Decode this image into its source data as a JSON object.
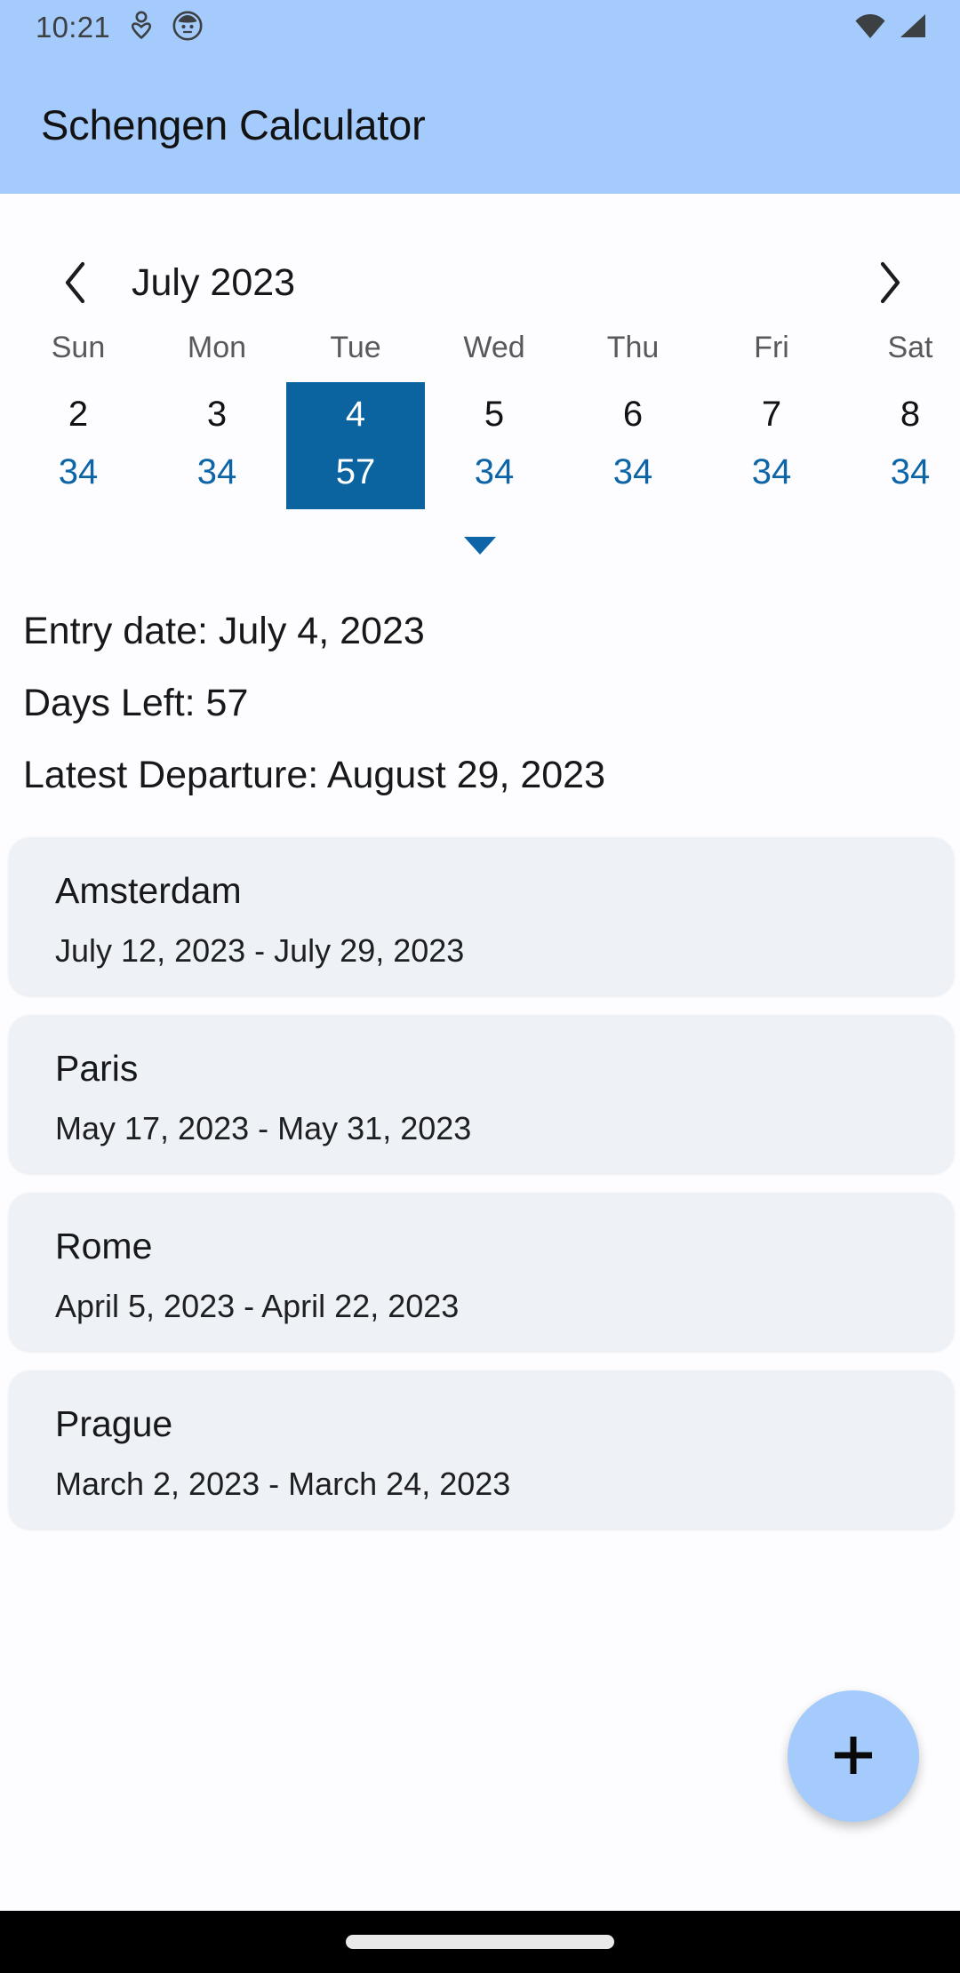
{
  "status_bar": {
    "clock": "10:21",
    "notification_icons": [
      "person-icon",
      "app-badge-icon"
    ],
    "system_icons": [
      "wifi-icon",
      "cellular-signal-icon"
    ],
    "background_color": "#a4cbfb"
  },
  "app_bar": {
    "title": "Schengen Calculator",
    "background_color": "#a4cbfb"
  },
  "calendar": {
    "prev_icon": "chevron-left-icon",
    "next_icon": "chevron-right-icon",
    "month_label": "July 2023",
    "expand_icon": "chevron-down-icon",
    "accent_color": "#0b639f",
    "count_color": "#0d65a8",
    "days": [
      {
        "name": "Sun",
        "number": "2",
        "count": "34",
        "selected": false
      },
      {
        "name": "Mon",
        "number": "3",
        "count": "34",
        "selected": false
      },
      {
        "name": "Tue",
        "number": "4",
        "count": "57",
        "selected": true
      },
      {
        "name": "Wed",
        "number": "5",
        "count": "34",
        "selected": false
      },
      {
        "name": "Thu",
        "number": "6",
        "count": "34",
        "selected": false
      },
      {
        "name": "Fri",
        "number": "7",
        "count": "34",
        "selected": false
      },
      {
        "name": "Sat",
        "number": "8",
        "count": "34",
        "selected": false
      }
    ]
  },
  "summary": {
    "entry_date": "Entry date: July 4, 2023",
    "days_left": "Days Left: 57",
    "latest_departure": "Latest Departure: August 29, 2023"
  },
  "trips": [
    {
      "name": "Amsterdam",
      "dates": "July 12, 2023 - July 29, 2023"
    },
    {
      "name": "Paris",
      "dates": "May 17, 2023 - May 31, 2023"
    },
    {
      "name": "Rome",
      "dates": "April 5, 2023 - April 22, 2023"
    },
    {
      "name": "Prague",
      "dates": "March 2, 2023 - March 24, 2023"
    }
  ],
  "fab": {
    "icon": "plus-icon",
    "background_color": "#a4cbfb"
  },
  "nav_bar": {
    "gesture_handle": "home-gesture-pill"
  }
}
